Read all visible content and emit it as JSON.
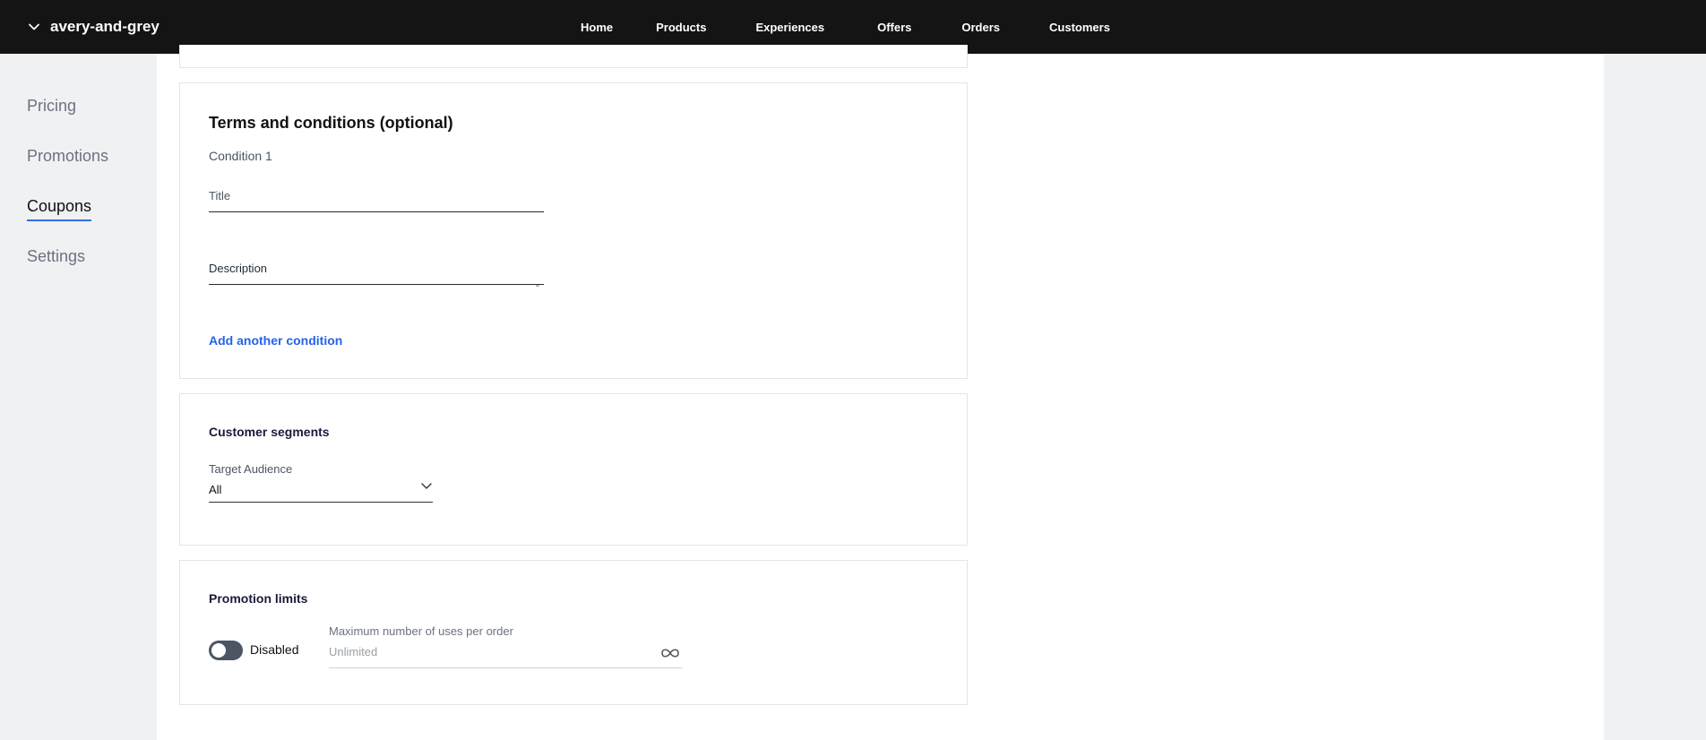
{
  "brand": {
    "name": "avery-and-grey"
  },
  "nav": {
    "items": [
      {
        "label": "Home",
        "active": false
      },
      {
        "label": "Products",
        "active": false
      },
      {
        "label": "Experiences",
        "active": false
      },
      {
        "label": "Offers",
        "active": true
      },
      {
        "label": "Orders",
        "active": false
      },
      {
        "label": "Customers",
        "active": false
      }
    ]
  },
  "sidebar": {
    "items": [
      {
        "label": "Pricing",
        "active": false
      },
      {
        "label": "Promotions",
        "active": false
      },
      {
        "label": "Coupons",
        "active": true
      },
      {
        "label": "Settings",
        "active": false
      }
    ]
  },
  "terms": {
    "title": "Terms and conditions (optional)",
    "condition_label": "Condition 1",
    "title_placeholder": "Title",
    "description_placeholder": "Description",
    "add_condition": "Add another condition"
  },
  "segments": {
    "title": "Customer segments",
    "target_label": "Target Audience",
    "target_value": "All"
  },
  "limits": {
    "title": "Promotion limits",
    "toggle_label": "Disabled",
    "toggle_on": false,
    "max_label": "Maximum number of uses per order",
    "max_placeholder": "Unlimited"
  },
  "colors": {
    "accent": "#2f6fe6",
    "link": "#2563eb",
    "topbar": "#141414"
  }
}
